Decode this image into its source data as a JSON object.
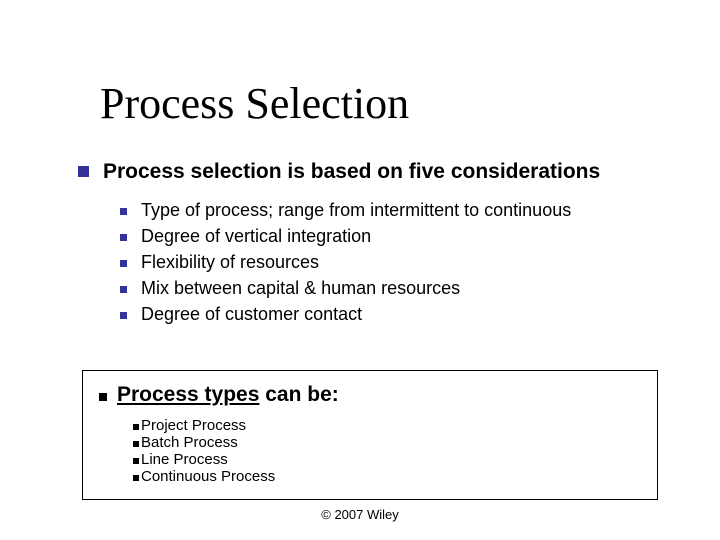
{
  "title": "Process Selection",
  "level1": "Process selection is based on five considerations",
  "level2": [
    "Type of process; range from intermittent to continuous",
    "Degree of vertical integration",
    "Flexibility of resources",
    "Mix between capital & human resources",
    "Degree of customer contact"
  ],
  "textbox": {
    "heading_underlined": "Process types",
    "heading_rest": " can be:",
    "items": [
      "Project Process",
      "Batch Process",
      "Line Process",
      "Continuous Process"
    ]
  },
  "footer": "© 2007 Wiley"
}
